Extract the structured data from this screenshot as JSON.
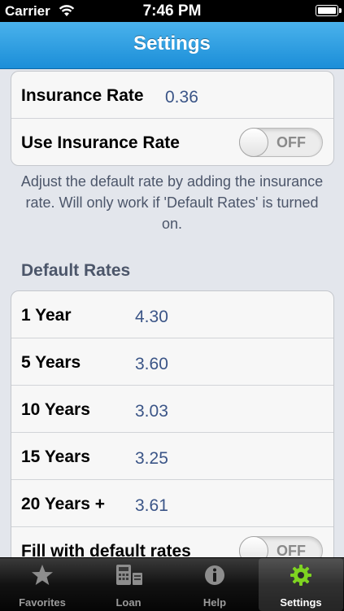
{
  "status_bar": {
    "carrier": "Carrier",
    "time": "7:46 PM"
  },
  "nav": {
    "title": "Settings"
  },
  "insurance": {
    "rate_label": "Insurance Rate",
    "rate_value": "0.36",
    "use_label": "Use Insurance Rate",
    "use_switch": "OFF"
  },
  "note": "Adjust the default rate by adding the insurance rate. Will only work if 'Default Rates' is turned on.",
  "default_rates": {
    "header": "Default Rates",
    "rows": [
      {
        "label": "1 Year",
        "value": "4.30"
      },
      {
        "label": "5 Years",
        "value": "3.60"
      },
      {
        "label": "10 Years",
        "value": "3.03"
      },
      {
        "label": "15 Years",
        "value": "3.25"
      },
      {
        "label": "20 Years +",
        "value": "3.61"
      }
    ],
    "fill_label": "Fill with default rates",
    "fill_switch": "OFF"
  },
  "tabs": [
    {
      "label": "Favorites",
      "icon": "star-icon"
    },
    {
      "label": "Loan",
      "icon": "calculator-icon"
    },
    {
      "label": "Help",
      "icon": "info-icon"
    },
    {
      "label": "Settings",
      "icon": "gear-icon",
      "active": true
    }
  ],
  "colors": {
    "accent": "#1b8ed8",
    "value_text": "#3b5587",
    "active_tab_icon": "#7ed321"
  }
}
